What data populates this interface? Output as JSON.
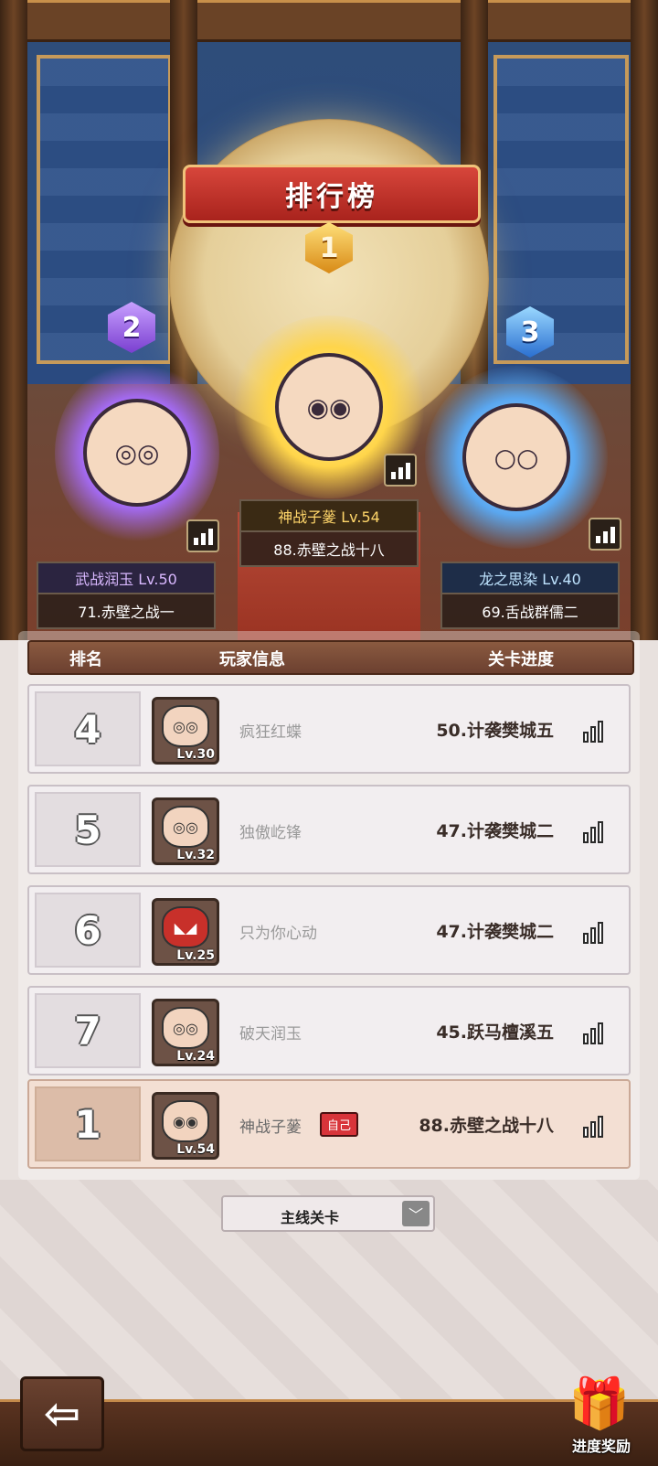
{
  "title": "排行榜",
  "podium": [
    {
      "rank": "1",
      "name_level": "神战子蓌 Lv.54",
      "progress": "88.赤壁之战十八"
    },
    {
      "rank": "2",
      "name_level": "武战润玉 Lv.50",
      "progress": "71.赤壁之战一"
    },
    {
      "rank": "3",
      "name_level": "龙之思染 Lv.40",
      "progress": "69.舌战群儒二"
    }
  ],
  "table_headers": {
    "rank": "排名",
    "player": "玩家信息",
    "progress": "关卡进度"
  },
  "rows": [
    {
      "rank": "4",
      "level": "Lv.30",
      "name": "疯狂红蝶",
      "progress": "50.计袭樊城五"
    },
    {
      "rank": "5",
      "level": "Lv.32",
      "name": "独傲屹锋",
      "progress": "47.计袭樊城二"
    },
    {
      "rank": "6",
      "level": "Lv.25",
      "name": "只为你心动",
      "progress": "47.计袭樊城二"
    },
    {
      "rank": "7",
      "level": "Lv.24",
      "name": "破天润玉",
      "progress": "45.跃马檀溪五"
    }
  ],
  "self_row": {
    "rank": "1",
    "level": "Lv.54",
    "name": "神战子蓌",
    "tag": "自己",
    "progress": "88.赤壁之战十八"
  },
  "dropdown": {
    "selected": "主线关卡"
  },
  "reward_label": "进度奖励",
  "icons": {
    "back": "back-arrow-icon",
    "stats": "bar-chart-icon",
    "chevron": "chevron-down-icon",
    "chest": "treasure-chest-icon"
  },
  "colors": {
    "gold": "#d88a16",
    "purple": "#7a3fd0",
    "blue": "#2a6fd0",
    "self_tag": "#d8343a"
  }
}
